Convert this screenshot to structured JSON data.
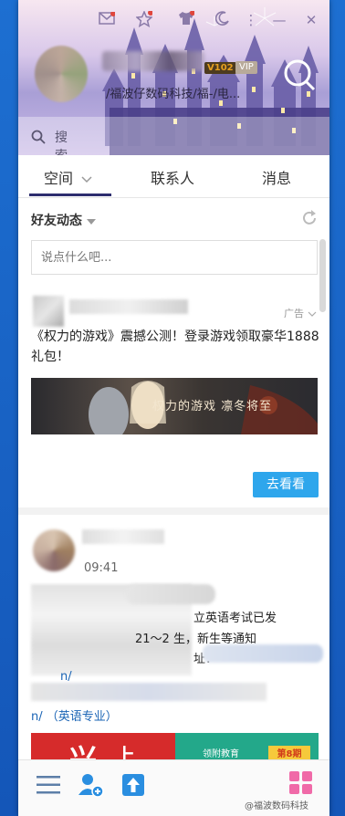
{
  "window_controls": {
    "mail_icon": "mail-icon",
    "star_icon": "star-icon",
    "shirt_icon": "shirt-icon",
    "moon_icon": "moon-icon",
    "more_label": "⋮",
    "minimize_label": "—",
    "close_label": "✕"
  },
  "profile": {
    "vip_level": "V102",
    "vip_tag": "VIP",
    "signature": "/福波仔数码科技/福-/电..."
  },
  "search": {
    "label": "搜索"
  },
  "tabs": [
    {
      "label": "空间",
      "active": true
    },
    {
      "label": "联系人",
      "active": false
    },
    {
      "label": "消息",
      "active": false
    }
  ],
  "feed": {
    "title": "好友动态",
    "compose_placeholder": "说点什么吧..."
  },
  "ad_post": {
    "ad_label": "广告",
    "text": "《权力的游戏》震撼公测！登录游戏领取豪华1888礼包！",
    "banner_title": "权力的游戏 凛冬将至",
    "action_label": "去看看"
  },
  "friend_post": {
    "time": "09:41",
    "line1": "立英语考试已发",
    "line2": "21～2 生，新生等通知",
    "line3": "址：",
    "line4": "n/",
    "line5": "n/ （英语专业）",
    "image_right_text": "领附教育",
    "image_right_badge": "第8期",
    "image_left_text": "兴",
    "image_left_sub": "上"
  },
  "bottom_bar": {
    "menu_icon": "menu-icon",
    "add_friend_icon": "add-friend-icon",
    "share_icon": "share-icon",
    "apps_icon": "apps-icon"
  },
  "watermark": "@福波数码科技",
  "colors": {
    "accent_blue": "#2ea6ec",
    "tab_underline": "#2d2d6e",
    "link": "#1a64b5",
    "vip_gold": "#e6a020"
  }
}
